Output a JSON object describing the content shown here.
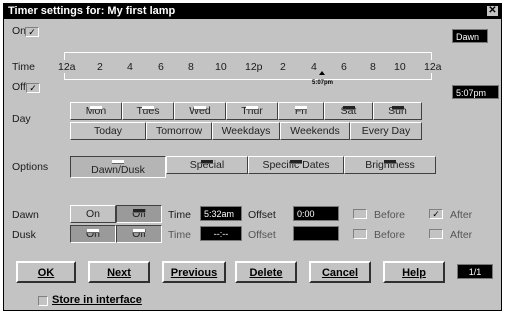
{
  "window": {
    "title": "Timer settings for: My first lamp"
  },
  "on": {
    "label": "On",
    "time": "Dawn"
  },
  "off": {
    "label": "Off",
    "time": "5:07pm"
  },
  "time_label": "Time",
  "timeline": {
    "ticks": [
      "12a",
      "2",
      "4",
      "6",
      "8",
      "10",
      "12p",
      "2",
      "4",
      "6",
      "8",
      "10",
      "12a"
    ],
    "marker_label": "5:07pm"
  },
  "day": {
    "label": "Day",
    "days": [
      "Mon",
      "Tues",
      "Wed",
      "Thur",
      "Fri",
      "Sat",
      "Sun"
    ],
    "groups": [
      "Today",
      "Tomorrow",
      "Weekdays",
      "Weekends",
      "Every Day"
    ]
  },
  "options": {
    "label": "Options",
    "tabs": [
      "Dawn/Dusk",
      "Special",
      "Specific Dates",
      "Brightness"
    ]
  },
  "dawn": {
    "label": "Dawn",
    "on": "On",
    "off": "Off",
    "time_label": "Time",
    "time": "5:32am",
    "offset_label": "Offset",
    "offset": "0:00",
    "before": "Before",
    "after": "After"
  },
  "dusk": {
    "label": "Dusk",
    "on": "On",
    "off": "Off",
    "time_label": "Time",
    "time": "--:--",
    "offset_label": "Offset",
    "offset": "",
    "before": "Before",
    "after": "After"
  },
  "buttons": {
    "ok": "OK",
    "next": "Next",
    "previous": "Previous",
    "delete": "Delete",
    "cancel": "Cancel",
    "help": "Help"
  },
  "page_counter": "1/1",
  "store": {
    "label": "Store in interface"
  }
}
